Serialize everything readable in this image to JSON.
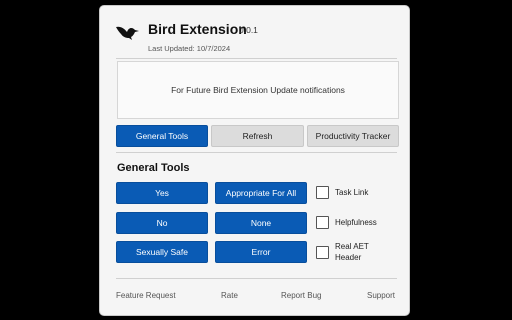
{
  "header": {
    "title": "Bird Extension",
    "version": "0.0.1",
    "last_updated": "Last Updated: 10/7/2024",
    "logo_icon": "bird-logo-icon"
  },
  "notification": {
    "text": "For Future Bird Extension Update notifications"
  },
  "tabs": [
    {
      "label": "General Tools",
      "active": true
    },
    {
      "label": "Refresh",
      "active": false
    },
    {
      "label": "Productivity Tracker",
      "active": false
    }
  ],
  "section": {
    "title": "General Tools"
  },
  "tools": {
    "yes": "Yes",
    "appropriate": "Appropriate For All",
    "no": "No",
    "none": "None",
    "sexually_safe": "Sexually Safe",
    "error": "Error"
  },
  "checkboxes": {
    "task_link": {
      "label": "Task Link",
      "checked": false
    },
    "helpfulness": {
      "label": "Helpfulness",
      "checked": false
    },
    "real_aet_header": {
      "label": "Real AET Header",
      "checked": false
    }
  },
  "footer": {
    "feature_request": "Feature Request",
    "rate": "Rate",
    "report_bug": "Report Bug",
    "support": "Support"
  },
  "colors": {
    "primary": "#0a5bb5",
    "secondary": "#dcdcdc",
    "background": "#f5f5f5"
  }
}
